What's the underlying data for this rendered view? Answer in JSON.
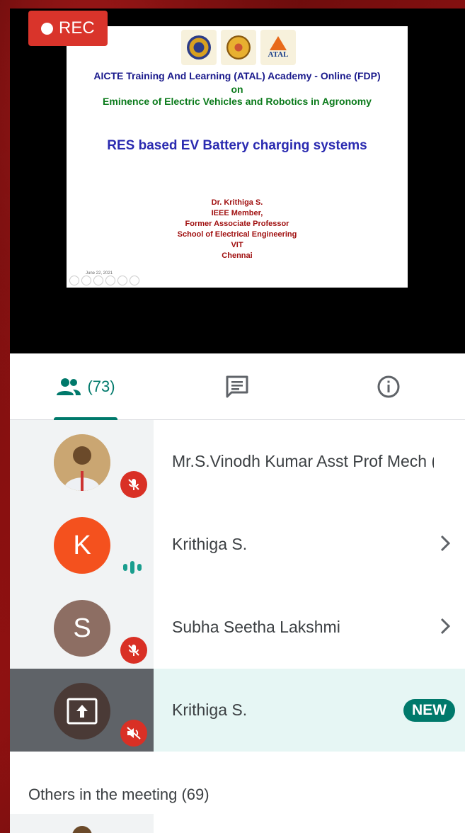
{
  "recording": {
    "label": "REC"
  },
  "slide": {
    "logo_text": "ATAL",
    "line1": "AICTE Training And Learning (ATAL) Academy   - Online (FDP)",
    "line2": "on",
    "line3": "Eminence of Electric Vehicles and Robotics in Agronomy",
    "title": "RES based EV Battery charging systems",
    "presenter_lines": [
      "Dr. Krithiga S.",
      "IEEE Member,",
      "Former Associate Professor",
      "School of Electrical Engineering",
      "VIT",
      "Chennai"
    ],
    "date": "June 22, 2021"
  },
  "tabs": {
    "people_count": "(73)",
    "active": "people"
  },
  "participants": [
    {
      "name": "Mr.S.Vinodh Kumar Asst Prof Mech (…",
      "avatar_type": "photo",
      "status": "muted"
    },
    {
      "name": "Krithiga S.",
      "avatar_letter": "K",
      "avatar_color": "#f4511e",
      "status": "speaking",
      "chevron": true
    },
    {
      "name": "Subha Seetha Lakshmi",
      "avatar_letter": "S",
      "avatar_color": "#8d6e63",
      "status": "muted",
      "chevron": true
    },
    {
      "name": "Krithiga S.",
      "avatar_type": "present-icon",
      "status": "audio-off",
      "badge": "NEW"
    }
  ],
  "others": {
    "title": "Others in the meeting (69)"
  },
  "colors": {
    "accent": "#00796b",
    "muted_red": "#d93025",
    "rec_red": "#d9342b"
  }
}
